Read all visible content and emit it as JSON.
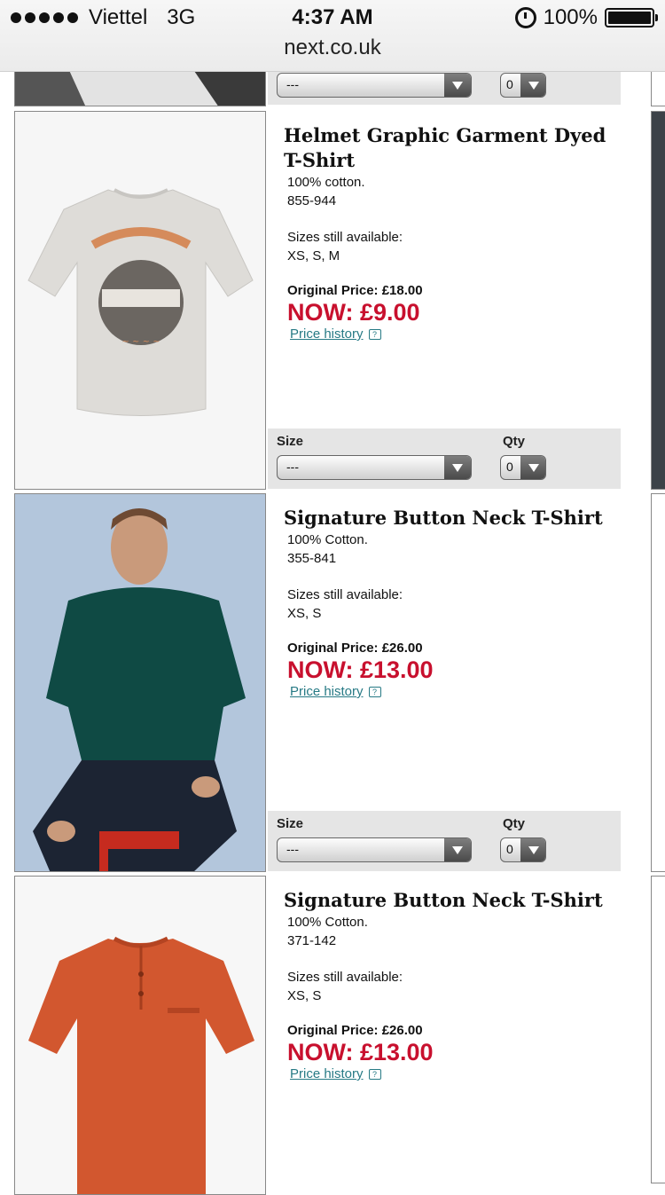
{
  "status_bar": {
    "carrier": "Viettel",
    "network": "3G",
    "time": "4:37 AM",
    "battery": "100%"
  },
  "browser": {
    "url": "next.co.uk"
  },
  "top_partial": {
    "size_value": "---",
    "qty_value": "0"
  },
  "products": [
    {
      "title": "Helmet Graphic Garment Dyed T-Shirt",
      "material": "100% cotton.",
      "code": "855-944",
      "sizes_label": "Sizes still available:",
      "sizes": "XS, S, M",
      "original_price": "Original Price: £18.00",
      "now_price": "NOW: £9.00",
      "price_history": "Price history",
      "size_label": "Size",
      "qty_label": "Qty",
      "size_value": "---",
      "qty_value": "0",
      "image": "grey-tshirt-helmet-graphic"
    },
    {
      "title": "Signature Button Neck T-Shirt",
      "material": "100% Cotton.",
      "code": "355-841",
      "sizes_label": "Sizes still available:",
      "sizes": "XS, S",
      "original_price": "Original Price: £26.00",
      "now_price": "NOW: £13.00",
      "price_history": "Price history",
      "size_label": "Size",
      "qty_label": "Qty",
      "size_value": "---",
      "qty_value": "0",
      "image": "model-green-henley"
    },
    {
      "title": "Signature Button Neck T-Shirt",
      "material": "100% Cotton.",
      "code": "371-142",
      "sizes_label": "Sizes still available:",
      "sizes": "XS, S",
      "original_price": "Original Price: £26.00",
      "now_price": "NOW: £13.00",
      "price_history": "Price history",
      "image": "orange-henley"
    }
  ],
  "colors": {
    "sale_red": "#c8102e",
    "link_teal": "#277a85",
    "select_bar": "#e5e5e5"
  }
}
